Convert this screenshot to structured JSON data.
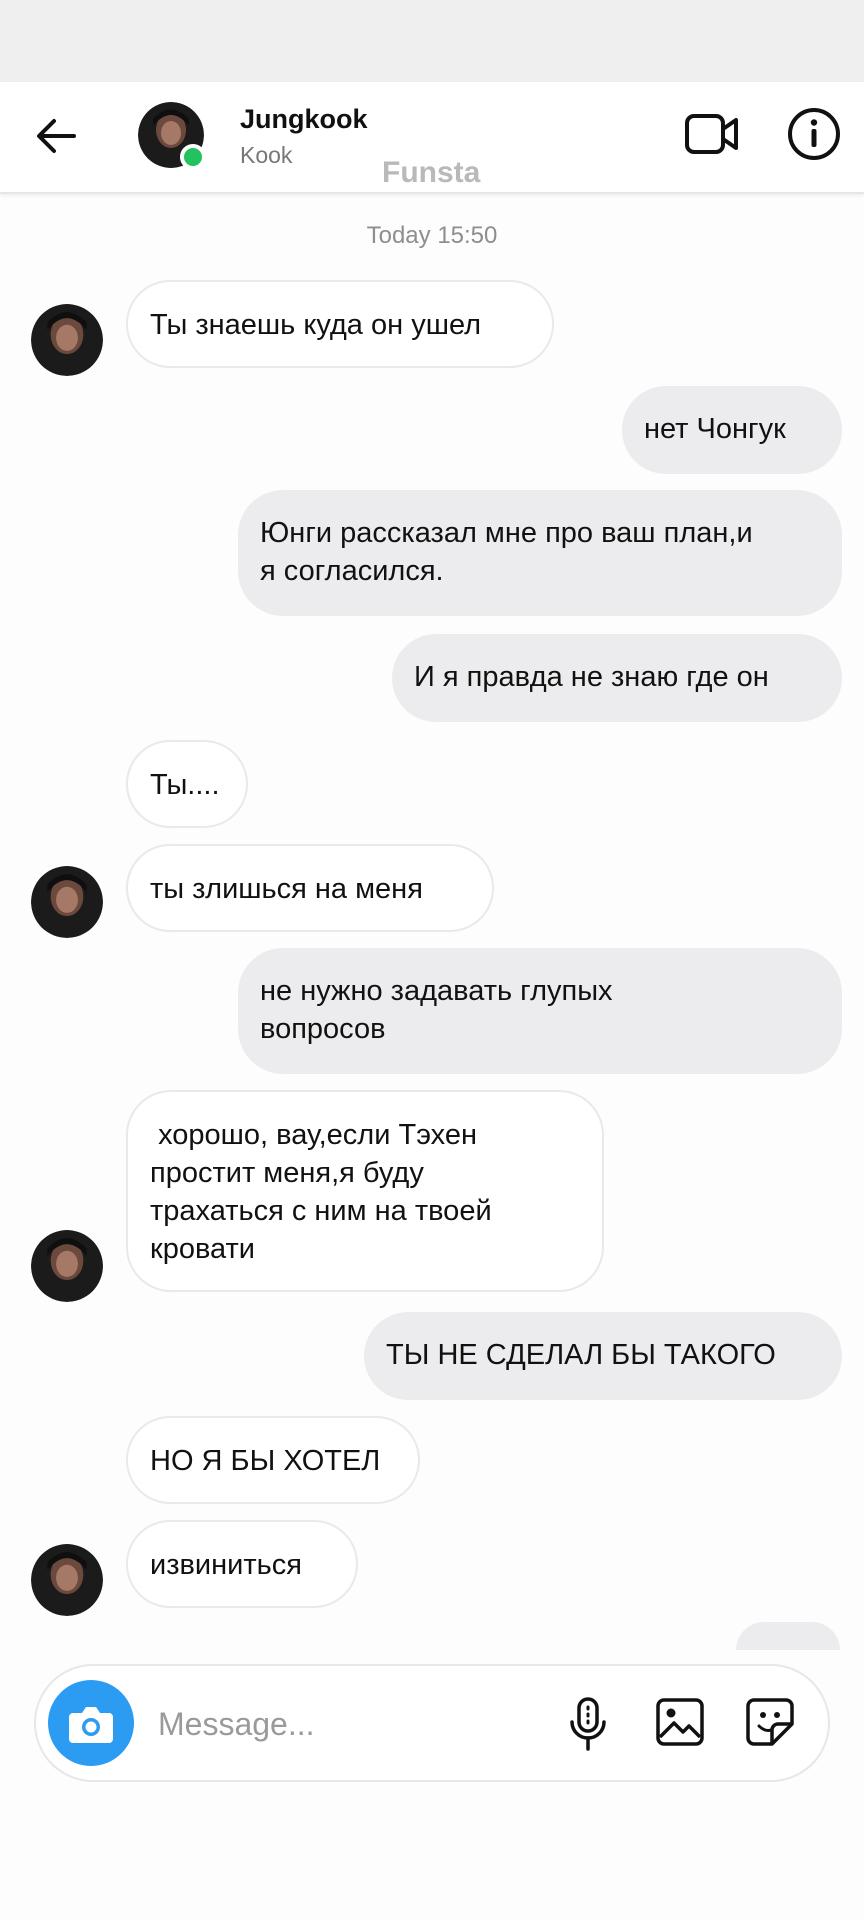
{
  "header": {
    "name": "Jungkook",
    "handle": "Kook",
    "watermark": "Funsta"
  },
  "timestamp": "Today 15:50",
  "messages": [
    {
      "from": "them",
      "text": "Ты знаешь куда он ушел"
    },
    {
      "from": "me",
      "text": "нет Чонгук"
    },
    {
      "from": "me",
      "text": "Юнги рассказал мне про ваш план,и\nя согласился."
    },
    {
      "from": "me",
      "text": "И я правда не знаю где он"
    },
    {
      "from": "them",
      "text": "Ты...."
    },
    {
      "from": "them",
      "text": "ты злишься на меня"
    },
    {
      "from": "me",
      "text": "не нужно задавать глупых\nвопросов"
    },
    {
      "from": "them",
      "text": " хорошо, вау,если Тэхен\nпростит меня,я буду\nтрахаться с ним на твоей\nкровати"
    },
    {
      "from": "me",
      "text": "ТЫ НЕ СДЕЛАЛ БЫ ТАКОГО"
    },
    {
      "from": "them",
      "text": "НО Я БЫ ХОТЕЛ"
    },
    {
      "from": "them",
      "text": "извиниться"
    }
  ],
  "composer": {
    "placeholder": "Message..."
  },
  "icons": {
    "back": "arrow-left-icon",
    "video": "video-camera-icon",
    "info": "info-icon",
    "camera": "camera-icon",
    "mic": "microphone-icon",
    "gallery": "image-icon",
    "sticker": "sticker-icon"
  },
  "colors": {
    "online": "#22c35e",
    "camera_button": "#2b9cf2",
    "outgoing_bubble": "#ececee"
  }
}
